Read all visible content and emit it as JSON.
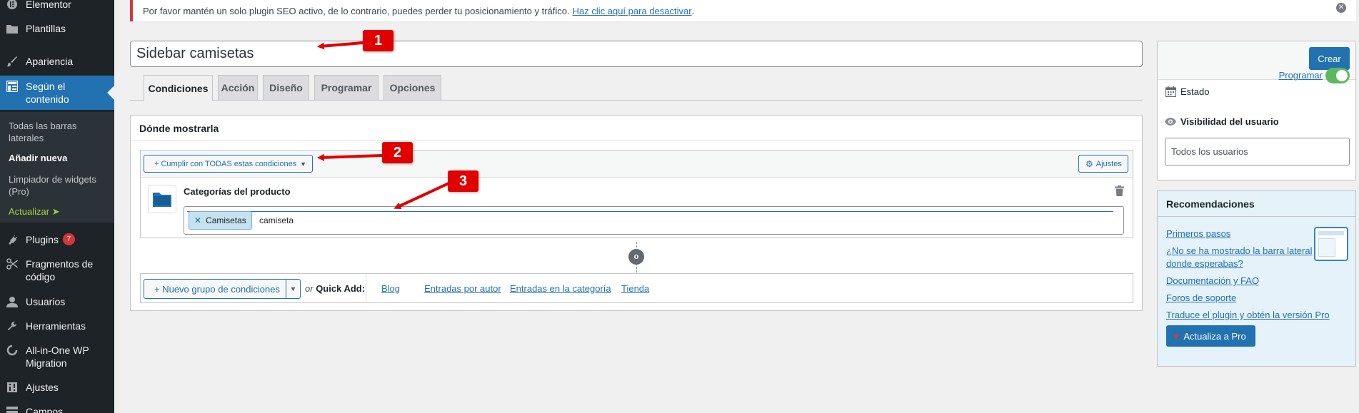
{
  "sidebar": {
    "items": [
      {
        "label": "Elementor",
        "icon": "elementor-icon"
      },
      {
        "label": "Plantillas",
        "icon": "folder-icon"
      },
      {
        "label": "Apariencia",
        "icon": "brush-icon"
      },
      {
        "label": "Según el contenido",
        "icon": "layout-icon"
      },
      {
        "label": "Plugins",
        "icon": "plug-icon",
        "badge": "7"
      },
      {
        "label": "Fragmentos de código",
        "icon": "scissors-icon"
      },
      {
        "label": "Usuarios",
        "icon": "user-icon"
      },
      {
        "label": "Herramientas",
        "icon": "wrench-icon"
      },
      {
        "label": "All-in-One WP Migration",
        "icon": "migration-icon"
      },
      {
        "label": "Ajustes",
        "icon": "settings-icon"
      },
      {
        "label": "Campos",
        "icon": "fields-icon"
      }
    ],
    "submenu": [
      {
        "label": "Todas las barras laterales"
      },
      {
        "label": "Añadir nueva"
      },
      {
        "label": "Limpiador de widgets (Pro)"
      },
      {
        "label": "Actualizar ➤"
      }
    ]
  },
  "notice": {
    "text": "Por favor mantén un solo plugin SEO activo, de lo contrario, puedes perder tu posicionamiento y tráfico.",
    "link": "Haz clic aquí para desactivar",
    "tail": "."
  },
  "title_value": "Sidebar camisetas",
  "tabs": [
    "Condiciones",
    "Acción",
    "Diseño",
    "Programar",
    "Opciones"
  ],
  "panel": {
    "header": "Dónde mostrarla",
    "match_button": "+ Cumplir con TODAS estas condiciones",
    "settings_button": "Ajustes",
    "condition_title": "Categorías del producto",
    "chip": "Camisetas",
    "typed_text": "camiseta",
    "or_label": "o",
    "new_group_button": "+ Nuevo grupo de condiciones",
    "quick_or": "or",
    "quick_add": "Quick Add:",
    "quick_links": [
      "Blog",
      "Entradas por autor",
      "Entradas en la categoría",
      "Tienda"
    ]
  },
  "publish": {
    "create_button": "Crear",
    "status_label": "Estado",
    "schedule_link": "Programar",
    "visibility_label": "Visibilidad del usuario",
    "users_value": "Todos los usuarios"
  },
  "recommendations": {
    "title": "Recomendaciones",
    "links": [
      "Primeros pasos",
      "¿No se ha mostrado la barra lateral donde esperabas?",
      "Documentación y FAQ",
      "Foros de soporte",
      "Traduce el plugin y obtén la versión Pro"
    ],
    "pro_button": "Actualiza a Pro"
  },
  "callouts": [
    "1",
    "2",
    "3"
  ],
  "colors": {
    "accent": "#2271b1",
    "sidebar_bg": "#1d2327",
    "callout": "#e00000",
    "toggle_on": "#5cb85c"
  }
}
